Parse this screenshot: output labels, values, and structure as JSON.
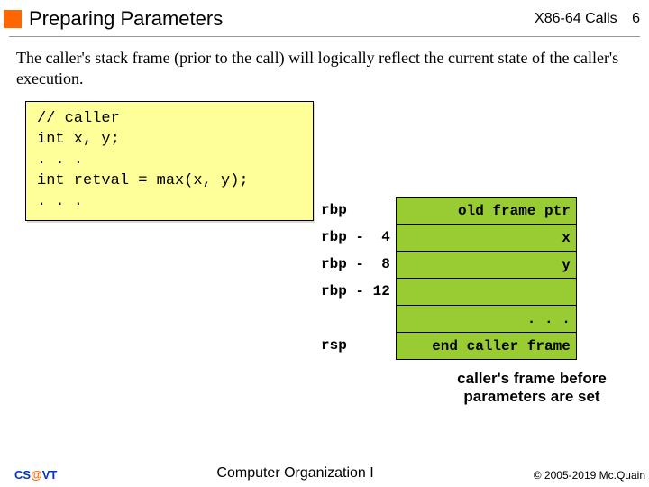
{
  "header": {
    "title": "Preparing Parameters",
    "right": "X86-64 Calls",
    "page": "6"
  },
  "body_text": "The caller's stack frame (prior to the call) will logically reflect the current state of the caller's execution.",
  "code": "// caller\nint x, y;\n. . .\nint retval = max(x, y);\n. . .",
  "stack": {
    "labels": [
      "rbp",
      "rbp -  4",
      "rbp -  8",
      "rbp - 12",
      "",
      "rsp"
    ],
    "cells": [
      "old frame ptr",
      "x",
      "y",
      "",
      ". . .",
      "end caller frame"
    ]
  },
  "caption": "caller's frame before parameters are set",
  "footer": {
    "left_cs": "CS",
    "left_at": "@",
    "left_vt": "VT",
    "center": "Computer Organization I",
    "right": "© 2005-2019 Mc.Quain"
  }
}
